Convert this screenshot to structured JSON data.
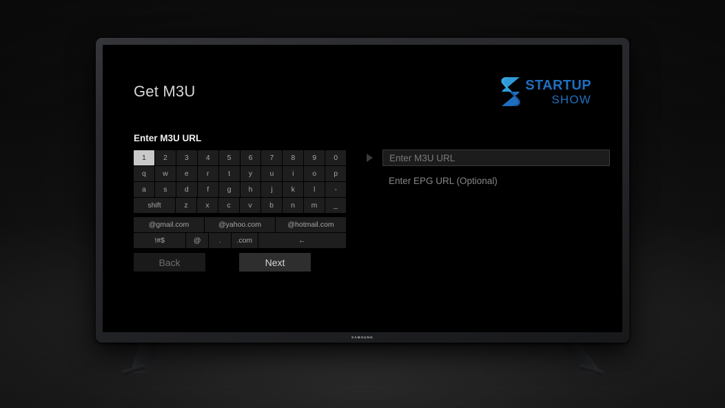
{
  "scene": {
    "device": {
      "brand_label": "SAMSUNG"
    }
  },
  "app": {
    "page_title": "Get M3U",
    "section_label": "Enter M3U URL",
    "logo": {
      "mark_icon": "startup-show-s-icon",
      "text_top": "STARTUP",
      "text_bottom": "SHOW",
      "color": "#1f6fc0",
      "color_light": "#2f9ad6"
    },
    "keyboard": {
      "selected_key": "1",
      "rows": [
        {
          "name": "number-row",
          "keys": [
            {
              "label": "1",
              "span": 1,
              "selected": true
            },
            {
              "label": "2",
              "span": 1,
              "selected": false
            },
            {
              "label": "3",
              "span": 1,
              "selected": false
            },
            {
              "label": "4",
              "span": 1,
              "selected": false
            },
            {
              "label": "5",
              "span": 1,
              "selected": false
            },
            {
              "label": "6",
              "span": 1,
              "selected": false
            },
            {
              "label": "7",
              "span": 1,
              "selected": false
            },
            {
              "label": "8",
              "span": 1,
              "selected": false
            },
            {
              "label": "9",
              "span": 1,
              "selected": false
            },
            {
              "label": "0",
              "span": 1,
              "selected": false
            }
          ]
        },
        {
          "name": "qwerty-row",
          "keys": [
            {
              "label": "q",
              "span": 1,
              "selected": false
            },
            {
              "label": "w",
              "span": 1,
              "selected": false
            },
            {
              "label": "e",
              "span": 1,
              "selected": false
            },
            {
              "label": "r",
              "span": 1,
              "selected": false
            },
            {
              "label": "t",
              "span": 1,
              "selected": false
            },
            {
              "label": "y",
              "span": 1,
              "selected": false
            },
            {
              "label": "u",
              "span": 1,
              "selected": false
            },
            {
              "label": "i",
              "span": 1,
              "selected": false
            },
            {
              "label": "o",
              "span": 1,
              "selected": false
            },
            {
              "label": "p",
              "span": 1,
              "selected": false
            }
          ]
        },
        {
          "name": "home-row",
          "keys": [
            {
              "label": "a",
              "span": 1,
              "selected": false
            },
            {
              "label": "s",
              "span": 1,
              "selected": false
            },
            {
              "label": "d",
              "span": 1,
              "selected": false
            },
            {
              "label": "f",
              "span": 1,
              "selected": false
            },
            {
              "label": "g",
              "span": 1,
              "selected": false
            },
            {
              "label": "h",
              "span": 1,
              "selected": false
            },
            {
              "label": "j",
              "span": 1,
              "selected": false
            },
            {
              "label": "k",
              "span": 1,
              "selected": false
            },
            {
              "label": "l",
              "span": 1,
              "selected": false
            },
            {
              "label": "-",
              "span": 1,
              "selected": false
            }
          ]
        },
        {
          "name": "shift-row",
          "keys": [
            {
              "label": "shift",
              "span": 2,
              "selected": false
            },
            {
              "label": "z",
              "span": 1,
              "selected": false
            },
            {
              "label": "x",
              "span": 1,
              "selected": false
            },
            {
              "label": "c",
              "span": 1,
              "selected": false
            },
            {
              "label": "v",
              "span": 1,
              "selected": false
            },
            {
              "label": "b",
              "span": 1,
              "selected": false
            },
            {
              "label": "n",
              "span": 1,
              "selected": false
            },
            {
              "label": "m",
              "span": 1,
              "selected": false
            },
            {
              "label": "_",
              "span": 1,
              "selected": false
            }
          ]
        },
        {
          "name": "domain-row",
          "keys": [
            {
              "label": "@gmail.com",
              "span": 3.5,
              "selected": false
            },
            {
              "label": "@yahoo.com",
              "span": 3.5,
              "selected": false
            },
            {
              "label": "@hotmail.com",
              "span": 3.5,
              "selected": false
            }
          ]
        },
        {
          "name": "symbol-row",
          "keys": [
            {
              "label": "!#$",
              "span": 2.6,
              "selected": false
            },
            {
              "label": "@",
              "span": 1.1,
              "selected": false
            },
            {
              "label": ".",
              "span": 1.1,
              "selected": false
            },
            {
              "label": ".com",
              "span": 1.3,
              "selected": false
            },
            {
              "label": "←",
              "span": 4.4,
              "selected": false
            }
          ]
        }
      ]
    },
    "buttons": {
      "back_label": "Back",
      "next_label": "Next"
    },
    "inputs": {
      "caret_icon": "play-triangle-caret-icon",
      "m3u": {
        "name": "m3u-url-input",
        "placeholder": "Enter M3U URL",
        "value": "",
        "focused": true
      },
      "epg": {
        "name": "epg-url-input",
        "placeholder": "Enter EPG URL (Optional)",
        "value": "",
        "focused": false
      }
    }
  }
}
